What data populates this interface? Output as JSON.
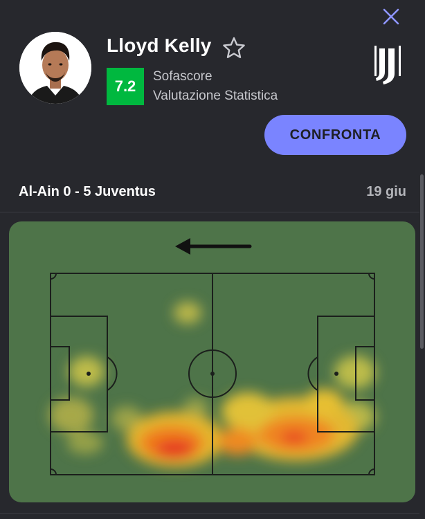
{
  "header": {
    "close_icon": "close-icon",
    "player_name": "Lloyd Kelly",
    "favorite_icon": "star-outline-icon",
    "rating": "7.2",
    "rating_source": "Sofascore",
    "rating_description": "Valutazione Statistica",
    "club_logo": "juventus-logo",
    "compare_label": "CONFRONTA"
  },
  "match": {
    "title": "Al-Ain 0 - 5 Juventus",
    "date": "19 giu"
  },
  "heatmap": {
    "attack_direction": "left",
    "direction_icon": "arrow-left-icon"
  },
  "colors": {
    "background": "#27282d",
    "accent": "#7a84ff",
    "rating_green": "#00b83f",
    "pitch": "#4e7449"
  }
}
